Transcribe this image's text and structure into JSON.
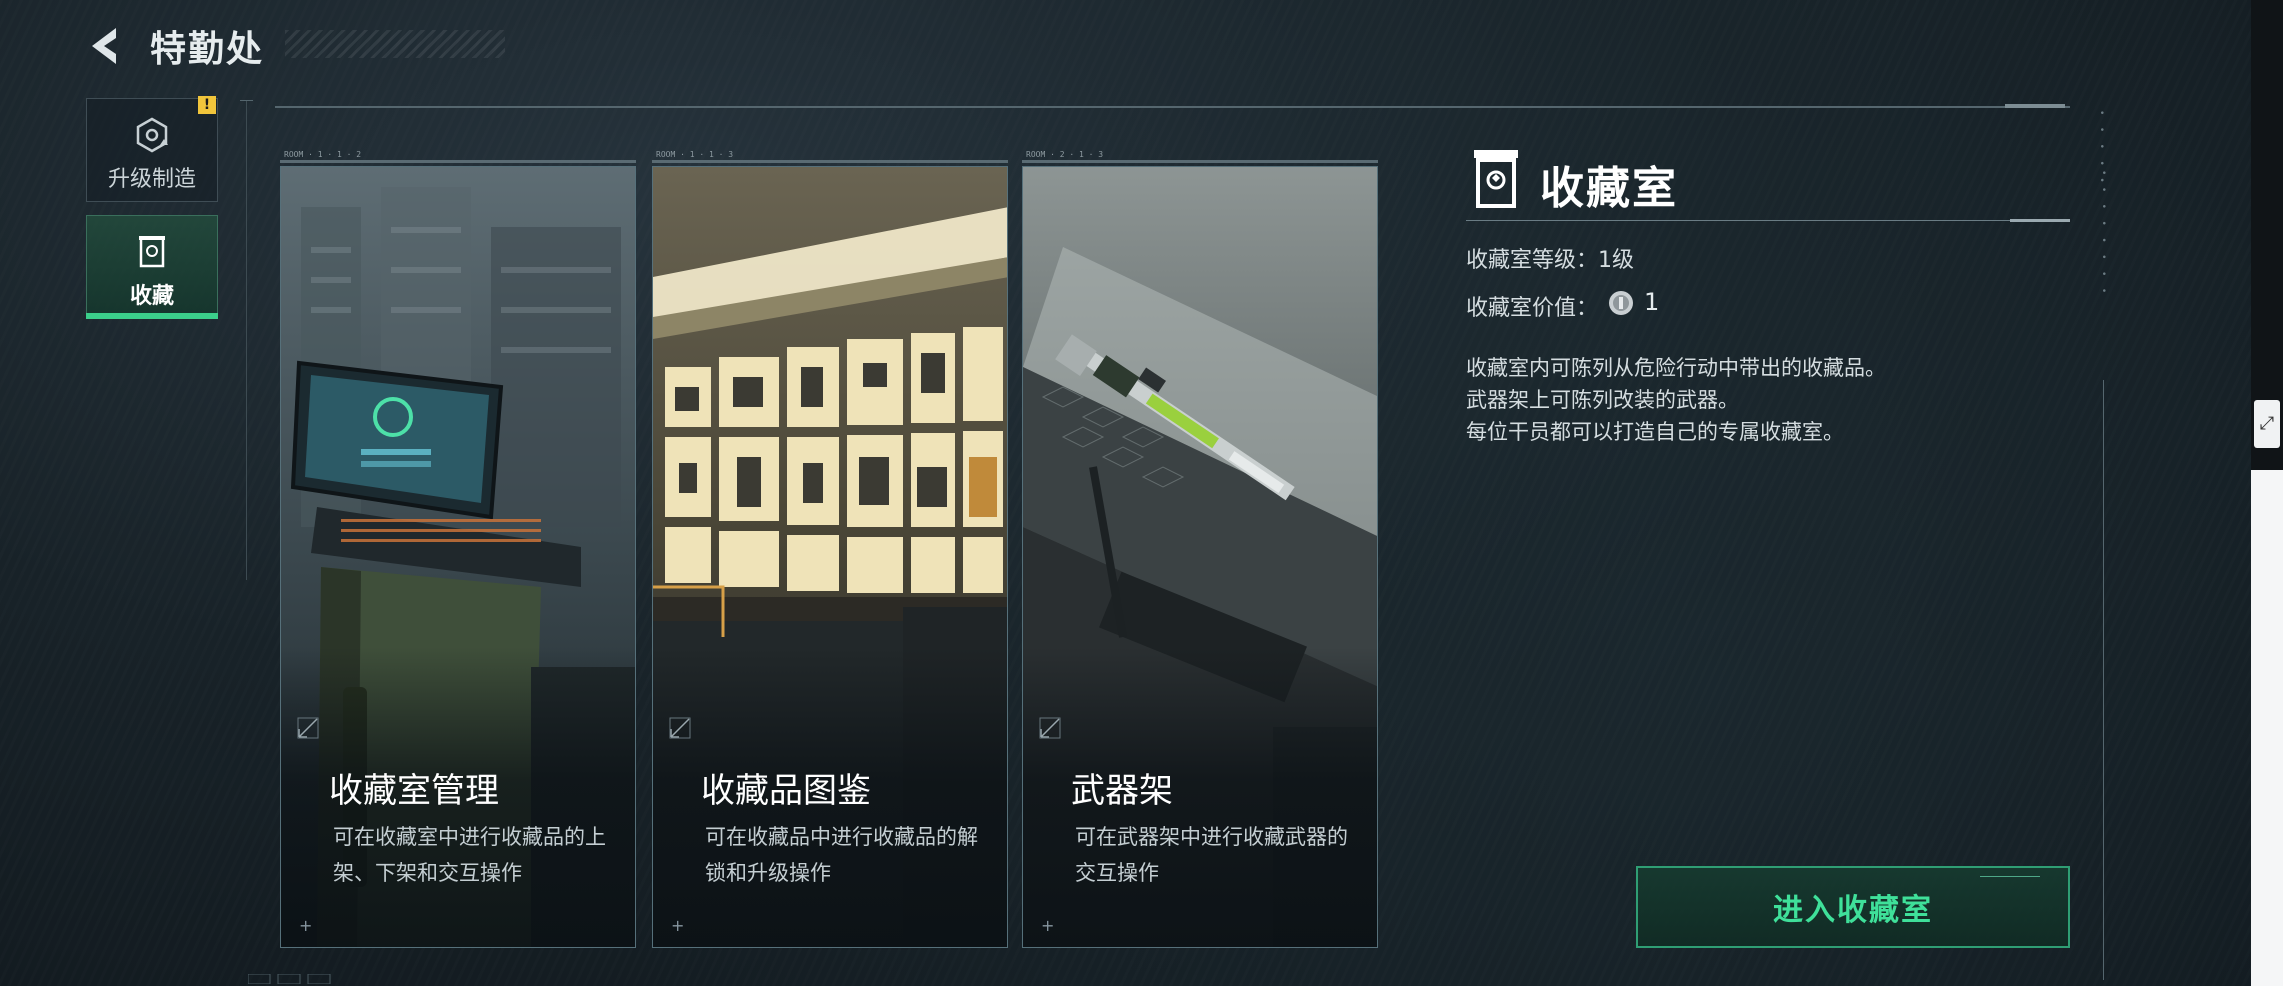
{
  "header": {
    "title": "特勤处"
  },
  "sidebar": {
    "items": [
      {
        "label": "升级制造",
        "icon": "upgrade-icon",
        "alert": "!"
      },
      {
        "label": "收藏",
        "icon": "collection-icon",
        "active": true
      }
    ]
  },
  "cards": [
    {
      "tab": "ROOM · 1 · 1 · 2",
      "title": "收藏室管理",
      "desc": "可在收藏室中进行收藏品的上架、下架和交互操作"
    },
    {
      "tab": "ROOM · 1 · 1 · 3",
      "title": "收藏品图鉴",
      "desc": "可在收藏品中进行收藏品的解锁和升级操作"
    },
    {
      "tab": "ROOM · 2 · 1 · 3",
      "title": "武器架",
      "desc": "可在武器架中进行收藏武器的交互操作"
    }
  ],
  "panel": {
    "title": "收藏室",
    "level_text": "收藏室等级：1级",
    "value_label": "收藏室价值：",
    "value": "1",
    "description": [
      "收藏室内可陈列从危险行动中带出的收藏品。",
      "武器架上可陈列改装的武器。",
      "每位干员都可以打造自己的专属收藏室。"
    ],
    "enter_label": "进入收藏室"
  },
  "colors": {
    "accent": "#3fe09a",
    "warning": "#f1c53b",
    "background": "#182228"
  }
}
